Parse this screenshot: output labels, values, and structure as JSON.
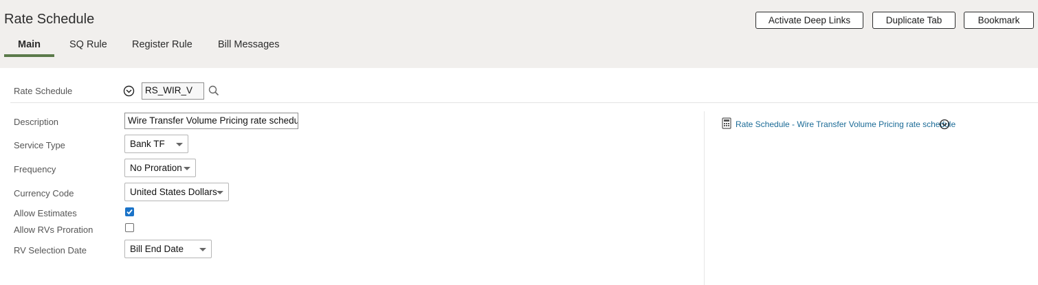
{
  "page": {
    "title": "Rate Schedule"
  },
  "header_buttons": {
    "activate_deep_links": "Activate Deep Links",
    "duplicate_tab": "Duplicate Tab",
    "bookmark": "Bookmark"
  },
  "tabs": [
    {
      "label": "Main",
      "active": true
    },
    {
      "label": "SQ Rule",
      "active": false
    },
    {
      "label": "Register Rule",
      "active": false
    },
    {
      "label": "Bill Messages",
      "active": false
    }
  ],
  "rate_schedule": {
    "label": "Rate Schedule",
    "value": "RS_WIR_V"
  },
  "form": {
    "description": {
      "label": "Description",
      "value": "Wire Transfer Volume Pricing rate schedu"
    },
    "service_type": {
      "label": "Service Type",
      "value": "Bank TF"
    },
    "frequency": {
      "label": "Frequency",
      "value": "No Proration"
    },
    "currency_code": {
      "label": "Currency Code",
      "value": "United States Dollars"
    },
    "allow_estimates": {
      "label": "Allow Estimates",
      "checked": true
    },
    "allow_rvs_proration": {
      "label": "Allow RVs Proration",
      "checked": false
    },
    "rv_selection_date": {
      "label": "RV Selection Date",
      "value": "Bill End Date"
    }
  },
  "context_link": {
    "text": "Rate Schedule - Wire Transfer Volume Pricing rate schedule",
    "icon": "calculator-icon"
  },
  "colors": {
    "tab_accent": "#5b7a4a",
    "link": "#1a6a96",
    "checkbox_on": "#1a73c8",
    "header_bg": "#f1efed"
  }
}
